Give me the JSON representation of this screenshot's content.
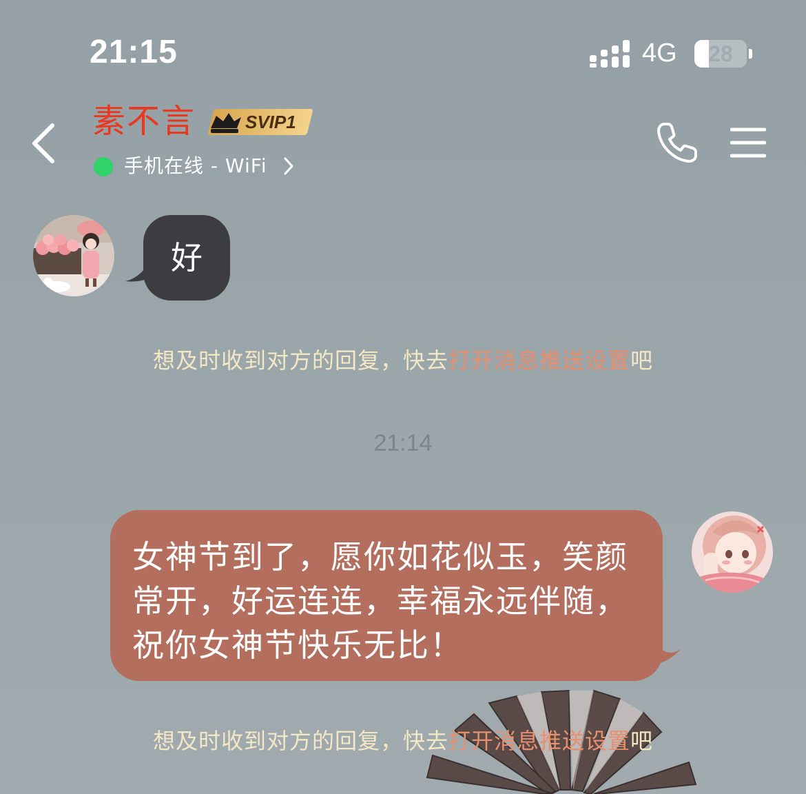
{
  "status_bar": {
    "time": "21:15",
    "network": "4G",
    "battery": "28",
    "battery_level": 0.28
  },
  "header": {
    "contact_name": "素不言",
    "vip_label": "SVIP1",
    "online_status": "手机在线 - WiFi",
    "icons": [
      "back-icon",
      "phone-icon",
      "menu-icon",
      "chevron-right-icon",
      "signal-icon",
      "battery-icon"
    ]
  },
  "messages": [
    {
      "direction": "received",
      "text": "好"
    },
    {
      "direction": "sent",
      "text": "女神节到了，愿你如花似玉，笑颜常开，好运连连，幸福永远伴随，祝你女神节快乐无比！"
    }
  ],
  "notices": [
    {
      "prefix": "想及时收到对方的回复，快去",
      "link": "打开消息推送设置",
      "suffix": "吧"
    },
    {
      "prefix": "想及时收到对方的回复，快去",
      "link": "打开消息推送设置",
      "suffix": "吧"
    }
  ],
  "timestamp": "21:14",
  "colors": {
    "background": "#9aa5aa",
    "contact_name": "#e8391e",
    "received_bubble": "#3c3c41",
    "sent_bubble": "#b46e5e",
    "notice_text": "#f4e7c4",
    "notice_link": "#e88f6e",
    "online_dot": "#2fd36a"
  }
}
